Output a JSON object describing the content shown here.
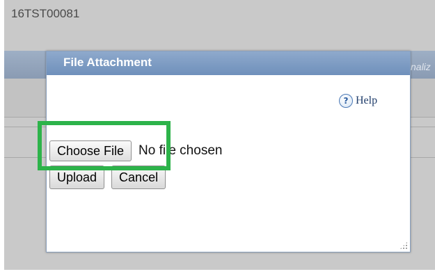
{
  "page": {
    "case_id": "16TST00081",
    "bar_right_text": "naliz"
  },
  "dialog": {
    "title": "File Attachment",
    "help": {
      "label": "Help",
      "icon": "help-circle-icon",
      "glyph": "?"
    },
    "file_input": {
      "button_label": "Choose File",
      "status_text": "No file chosen"
    },
    "buttons": {
      "upload_label": "Upload",
      "cancel_label": "Cancel"
    }
  },
  "annotation": {
    "highlight_color": "#2db34a",
    "target": "Choose File"
  },
  "colors": {
    "title_bar": "#7a98c2",
    "backdrop": "#c9c9c9"
  }
}
